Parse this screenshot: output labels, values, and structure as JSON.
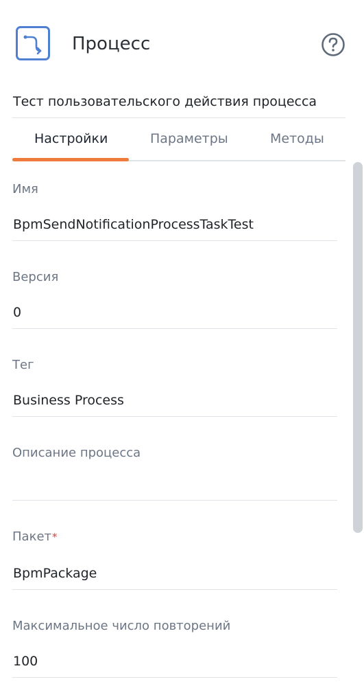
{
  "header": {
    "title": "Процесс",
    "icon": "process-icon",
    "help_icon": "help-icon",
    "accent_color": "#4f7fd3"
  },
  "subtitle": "Тест пользовательского действия процесса",
  "tabs": [
    {
      "label": "Настройки",
      "active": true
    },
    {
      "label": "Параметры",
      "active": false
    },
    {
      "label": "Методы",
      "active": false
    }
  ],
  "tab_active_color": "#ee7b3c",
  "fields": {
    "name": {
      "label": "Имя",
      "value": "BpmSendNotificationProcessTaskTest"
    },
    "version": {
      "label": "Версия",
      "value": "0"
    },
    "tag": {
      "label": "Тег",
      "value": "Business Process"
    },
    "description": {
      "label": "Описание процесса",
      "value": ""
    },
    "package": {
      "label": "Пакет",
      "required_mark": "*",
      "value": "BpmPackage"
    },
    "max_retries": {
      "label": "Максимальное число повторений",
      "value": "100"
    }
  }
}
